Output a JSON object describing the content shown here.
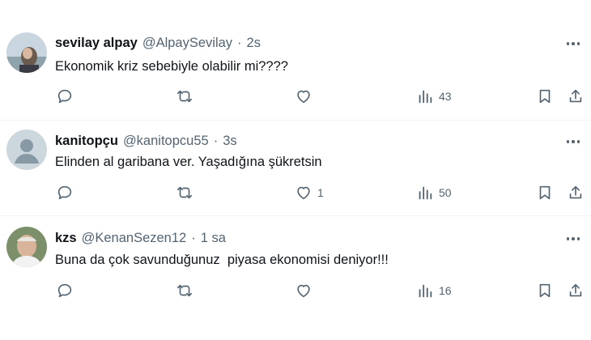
{
  "colors": {
    "text": "#0f1419",
    "secondary": "#536471",
    "divider": "#eff3f4"
  },
  "tweets": [
    {
      "name": "sevilay alpay",
      "handle": "@AlpaySevilay",
      "separator": "·",
      "time": "2s",
      "text": "Ekonomik kriz sebebiyle olabilir mi????",
      "avatar": "photo-avatar",
      "likes": "",
      "views": "43"
    },
    {
      "name": "kanitopçu",
      "handle": "@kanitopcu55",
      "separator": "·",
      "time": "3s",
      "text": "Elinden al garibana ver. Yaşadığına şükretsin",
      "avatar": "default-avatar",
      "likes": "1",
      "views": "50"
    },
    {
      "name": "kzs",
      "handle": "@KenanSezen12",
      "separator": "·",
      "time": "1 sa",
      "text": "Buna da çok savunduğunuz  piyasa ekonomisi deniyor!!!",
      "avatar": "photo-avatar",
      "likes": "",
      "views": "16"
    }
  ]
}
